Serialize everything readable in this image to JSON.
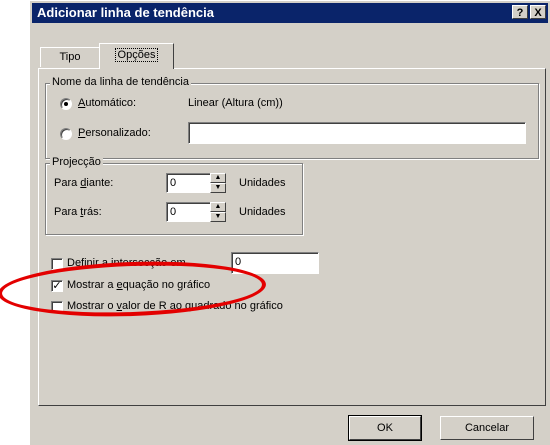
{
  "dialog": {
    "title": "Adicionar linha de tendência",
    "help_button": "?",
    "close_button": "X"
  },
  "tabs": [
    {
      "label": "Tipo",
      "active": false
    },
    {
      "label": "Opções",
      "active": true
    }
  ],
  "name_group": {
    "legend": "Nome da linha de tendência",
    "automatic": {
      "label_pre": "",
      "label_key": "A",
      "label_post": "utomático:",
      "selected": true,
      "value": "Linear (Altura (cm))"
    },
    "custom": {
      "label_pre": "",
      "label_key": "P",
      "label_post": "ersonalizado:",
      "selected": false,
      "value": ""
    }
  },
  "projection_group": {
    "legend": "Projecção",
    "forward": {
      "label_pre": "Para ",
      "label_key": "d",
      "label_post": "iante:",
      "value": "0",
      "unit": "Unidades"
    },
    "backward": {
      "label_pre": "Para ",
      "label_key": "t",
      "label_post": "rás:",
      "value": "0",
      "unit": "Unidades"
    }
  },
  "options": {
    "set_intercept": {
      "label": "Definir a intersecção em",
      "checked": false,
      "value": "0"
    },
    "show_equation": {
      "label_pre": "Mostrar a ",
      "label_key": "e",
      "label_post": "quação no gráfico",
      "checked": true
    },
    "show_r_squared": {
      "label_pre": "Mostrar o ",
      "label_key": "v",
      "label_post": "alor de R ao quadrado no gráfico",
      "checked": false
    }
  },
  "buttons": {
    "ok": "OK",
    "cancel": "Cancelar"
  },
  "annotation": {
    "color": "#e30000"
  }
}
